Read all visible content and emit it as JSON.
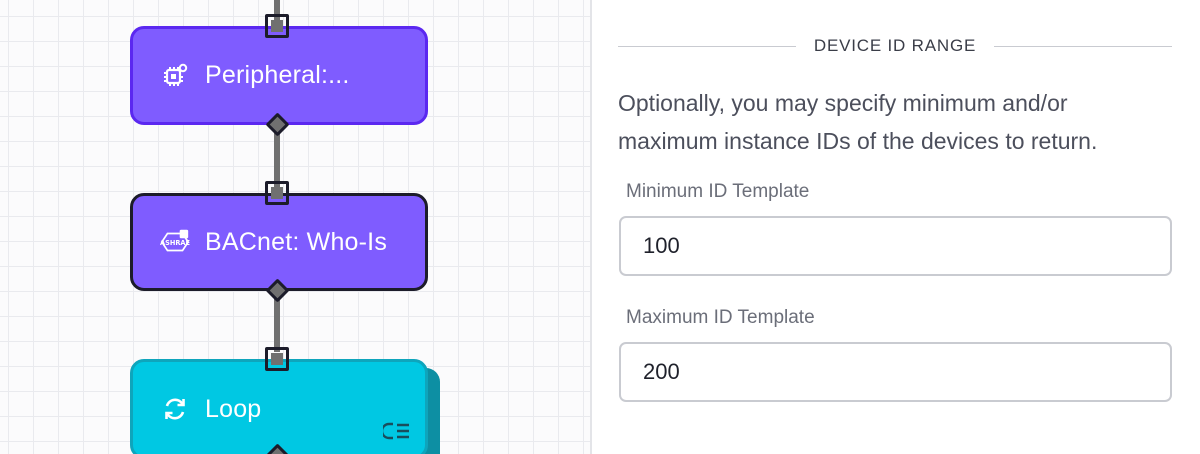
{
  "canvas": {
    "nodes": [
      {
        "label": "Peripheral:...",
        "icon": "chip-gear-icon",
        "color": "#7f5cff",
        "selected": true
      },
      {
        "label": "BACnet: Who-Is",
        "icon": "ashrae-icon",
        "icon_text": "ASHRAE",
        "color": "#7f5cff",
        "selected": false
      },
      {
        "label": "Loop",
        "icon": "loop-icon",
        "color": "#00c8e3",
        "badge_icon": "loop-branch-icon"
      }
    ]
  },
  "panel": {
    "section_title": "DEVICE ID RANGE",
    "help_text": "Optionally, you may specify minimum and/or maximum instance IDs of the devices to return.",
    "min_field": {
      "label": "Minimum ID Template",
      "value": "100"
    },
    "max_field": {
      "label": "Maximum ID Template",
      "value": "200"
    }
  },
  "colors": {
    "accent_purple": "#7f5cff",
    "selected_border": "#5b28f0",
    "loop_cyan": "#00c8e3"
  }
}
